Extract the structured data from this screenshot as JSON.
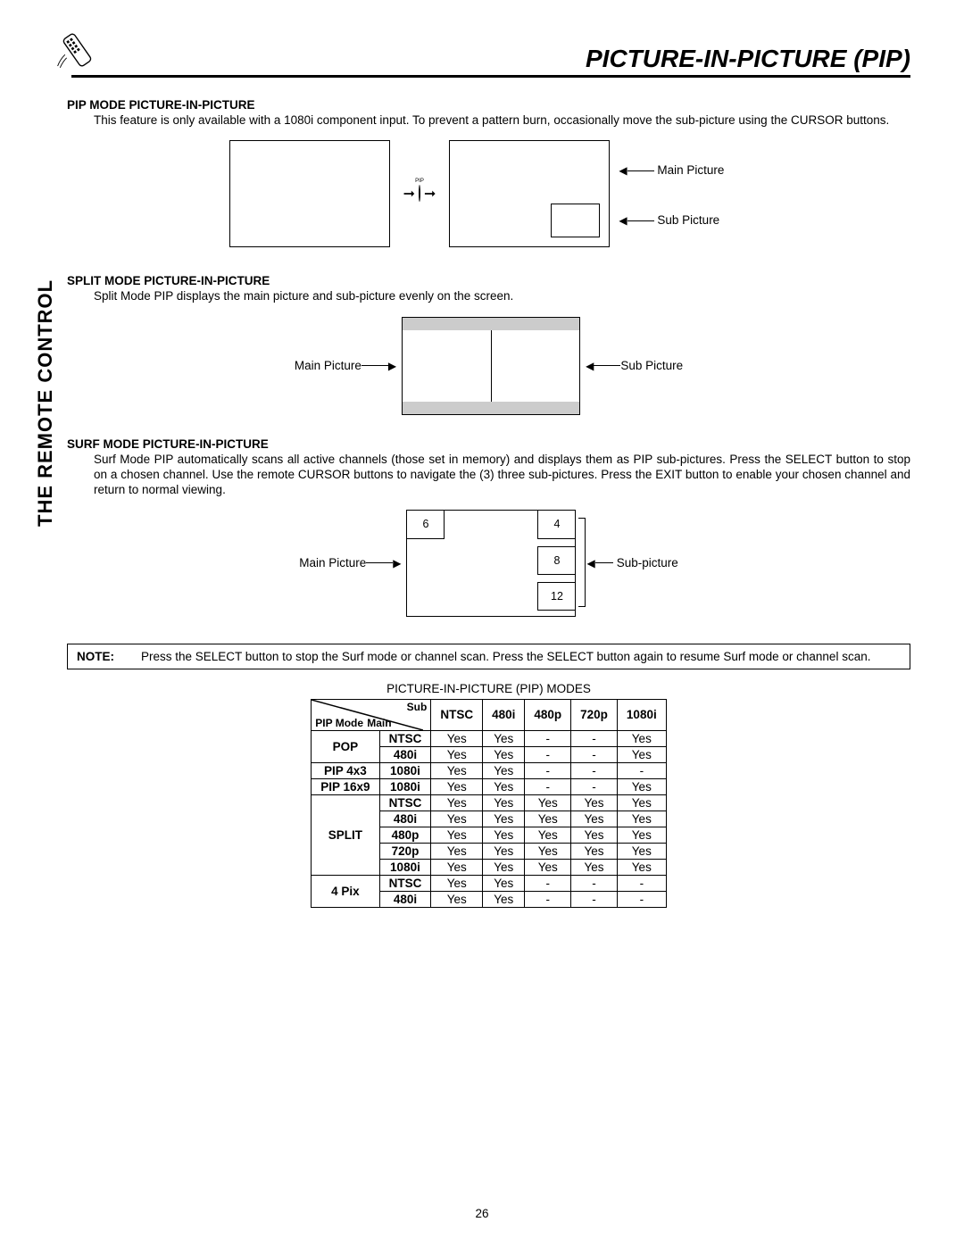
{
  "page": {
    "title": "PICTURE-IN-PICTURE (PIP)",
    "side_label": "THE REMOTE CONTROL",
    "number": "26"
  },
  "pip": {
    "heading": "PIP MODE PICTURE-IN-PICTURE",
    "body": "This feature is only available with a 1080i component input.  To prevent a pattern burn, occasionally move the sub-picture using the CURSOR buttons.",
    "button_label": "PIP",
    "main_label": "Main Picture",
    "sub_label": "Sub Picture"
  },
  "split": {
    "heading": "SPLIT MODE PICTURE-IN-PICTURE",
    "body": "Split Mode PIP displays the main picture and sub-picture evenly on the screen.",
    "main_label": "Main Picture",
    "sub_label": "Sub Picture"
  },
  "surf": {
    "heading": "SURF MODE PICTURE-IN-PICTURE",
    "body": "Surf Mode PIP automatically scans all active channels (those set in memory) and displays them as PIP sub-pictures.  Press the SELECT button to stop on a chosen channel.  Use the remote CURSOR buttons to navigate the (3) three sub-pictures.  Press the EXIT button to enable your chosen channel and return to normal viewing.",
    "main_label": "Main Picture",
    "sub_label": "Sub-picture",
    "channels": [
      "6",
      "4",
      "8",
      "12"
    ]
  },
  "note": {
    "label": "NOTE:",
    "text": "Press the SELECT button to stop the Surf mode or channel scan.  Press the SELECT button again to resume Surf mode or channel scan."
  },
  "table": {
    "caption": "PICTURE-IN-PICTURE (PIP) MODES",
    "corner_mode": "PIP Mode",
    "corner_main": "Main",
    "corner_sub": "Sub",
    "col_headers": [
      "NTSC",
      "480i",
      "480p",
      "720p",
      "1080i"
    ],
    "rows": [
      {
        "mode": "POP",
        "main": "NTSC",
        "NTSC": "Yes",
        "480i": "Yes",
        "480p": "-",
        "720p": "-",
        "1080i": "Yes"
      },
      {
        "mode": "",
        "main": "480i",
        "NTSC": "Yes",
        "480i": "Yes",
        "480p": "-",
        "720p": "-",
        "1080i": "Yes"
      },
      {
        "mode": "PIP 4x3",
        "main": "1080i",
        "NTSC": "Yes",
        "480i": "Yes",
        "480p": "-",
        "720p": "-",
        "1080i": "-"
      },
      {
        "mode": "PIP 16x9",
        "main": "1080i",
        "NTSC": "Yes",
        "480i": "Yes",
        "480p": "-",
        "720p": "-",
        "1080i": "Yes"
      },
      {
        "mode": "SPLIT",
        "main": "NTSC",
        "NTSC": "Yes",
        "480i": "Yes",
        "480p": "Yes",
        "720p": "Yes",
        "1080i": "Yes"
      },
      {
        "mode": "",
        "main": "480i",
        "NTSC": "Yes",
        "480i": "Yes",
        "480p": "Yes",
        "720p": "Yes",
        "1080i": "Yes"
      },
      {
        "mode": "",
        "main": "480p",
        "NTSC": "Yes",
        "480i": "Yes",
        "480p": "Yes",
        "720p": "Yes",
        "1080i": "Yes"
      },
      {
        "mode": "",
        "main": "720p",
        "NTSC": "Yes",
        "480i": "Yes",
        "480p": "Yes",
        "720p": "Yes",
        "1080i": "Yes"
      },
      {
        "mode": "",
        "main": "1080i",
        "NTSC": "Yes",
        "480i": "Yes",
        "480p": "Yes",
        "720p": "Yes",
        "1080i": "Yes"
      },
      {
        "mode": "4 Pix",
        "main": "NTSC",
        "NTSC": "Yes",
        "480i": "Yes",
        "480p": "-",
        "720p": "-",
        "1080i": "-"
      },
      {
        "mode": "",
        "main": "480i",
        "NTSC": "Yes",
        "480i": "Yes",
        "480p": "-",
        "720p": "-",
        "1080i": "-"
      }
    ]
  },
  "chart_data": {
    "type": "table",
    "title": "PICTURE-IN-PICTURE (PIP) MODES",
    "columns": [
      "PIP Mode",
      "Main",
      "NTSC",
      "480i",
      "480p",
      "720p",
      "1080i"
    ],
    "rows": [
      [
        "POP",
        "NTSC",
        "Yes",
        "Yes",
        "-",
        "-",
        "Yes"
      ],
      [
        "POP",
        "480i",
        "Yes",
        "Yes",
        "-",
        "-",
        "Yes"
      ],
      [
        "PIP 4x3",
        "1080i",
        "Yes",
        "Yes",
        "-",
        "-",
        "-"
      ],
      [
        "PIP 16x9",
        "1080i",
        "Yes",
        "Yes",
        "-",
        "-",
        "Yes"
      ],
      [
        "SPLIT",
        "NTSC",
        "Yes",
        "Yes",
        "Yes",
        "Yes",
        "Yes"
      ],
      [
        "SPLIT",
        "480i",
        "Yes",
        "Yes",
        "Yes",
        "Yes",
        "Yes"
      ],
      [
        "SPLIT",
        "480p",
        "Yes",
        "Yes",
        "Yes",
        "Yes",
        "Yes"
      ],
      [
        "SPLIT",
        "720p",
        "Yes",
        "Yes",
        "Yes",
        "Yes",
        "Yes"
      ],
      [
        "SPLIT",
        "1080i",
        "Yes",
        "Yes",
        "Yes",
        "Yes",
        "Yes"
      ],
      [
        "4 Pix",
        "NTSC",
        "Yes",
        "Yes",
        "-",
        "-",
        "-"
      ],
      [
        "4 Pix",
        "480i",
        "Yes",
        "Yes",
        "-",
        "-",
        "-"
      ]
    ]
  }
}
